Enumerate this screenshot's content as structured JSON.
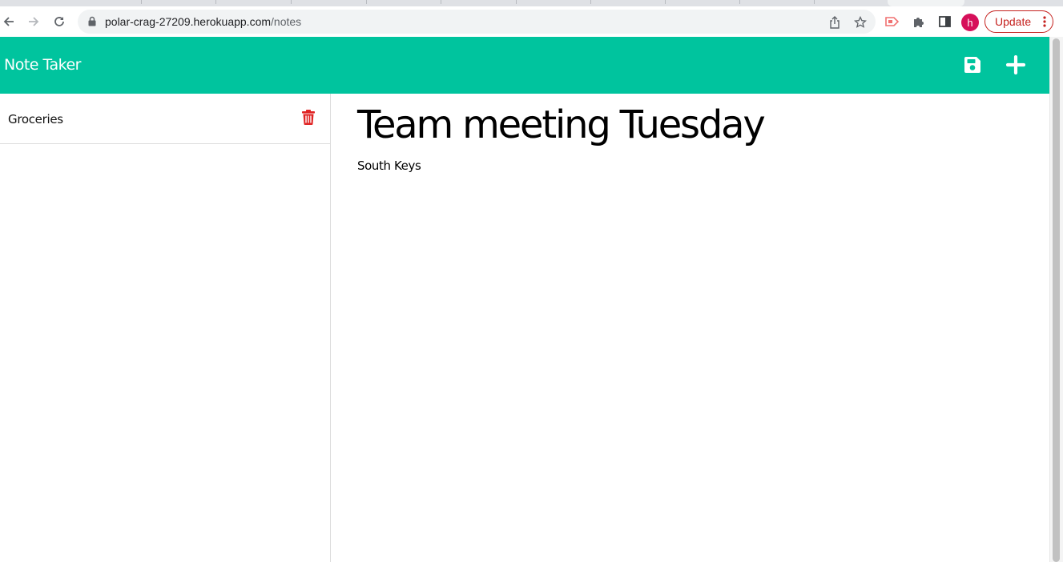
{
  "browser": {
    "url_host": "polar-crag-27209.herokuapp.com",
    "url_path": "/notes",
    "profile_initial": "h",
    "update_label": "Update",
    "icons": {
      "back": "arrow-left-icon",
      "forward": "arrow-right-icon",
      "reload": "reload-icon",
      "lock": "lock-icon",
      "share": "share-icon",
      "bookmark": "star-icon",
      "extension_one": "tag-extension-icon",
      "extensions": "puzzle-icon",
      "side_panel": "side-panel-icon",
      "menu": "kebab-menu-icon"
    }
  },
  "app": {
    "title": "Note Taker",
    "accent_color": "#00c49e",
    "actions": {
      "save": "save-icon",
      "new_note": "plus-icon"
    },
    "notes_list": [
      {
        "title": "Groceries",
        "delete_icon": "trash-icon",
        "delete_color": "#e02424"
      }
    ],
    "active_note": {
      "title": "Team meeting Tuesday",
      "body": "South Keys"
    }
  }
}
